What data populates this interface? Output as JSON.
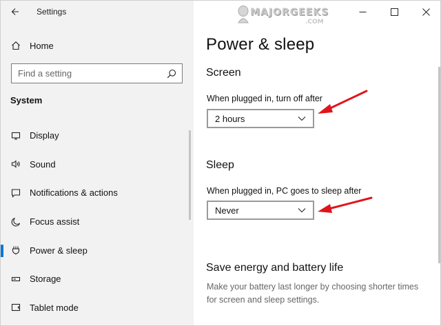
{
  "window": {
    "app_title": "Settings",
    "back_icon": "arrow-left-icon",
    "controls": [
      "minimize-icon",
      "maximize-icon",
      "close-icon"
    ]
  },
  "watermark": {
    "brand": "MAJORGEEKS",
    "suffix": ".COM"
  },
  "sidebar": {
    "home_label": "Home",
    "search_placeholder": "Find a setting",
    "section_label": "System",
    "active_item": "Power & sleep",
    "items": [
      {
        "label": "Display",
        "icon": "monitor-icon"
      },
      {
        "label": "Sound",
        "icon": "speaker-icon"
      },
      {
        "label": "Notifications & actions",
        "icon": "notifications-icon"
      },
      {
        "label": "Focus assist",
        "icon": "moon-icon"
      },
      {
        "label": "Power & sleep",
        "icon": "power-icon"
      },
      {
        "label": "Storage",
        "icon": "storage-icon"
      },
      {
        "label": "Tablet mode",
        "icon": "tablet-icon"
      }
    ]
  },
  "main": {
    "title": "Power & sleep",
    "screen": {
      "heading": "Screen",
      "label": "When plugged in, turn off after",
      "value": "2 hours"
    },
    "sleep": {
      "heading": "Sleep",
      "label": "When plugged in, PC goes to sleep after",
      "value": "Never"
    },
    "energy": {
      "heading": "Save energy and battery life",
      "description": "Make your battery last longer by choosing shorter times for screen and sleep settings."
    }
  },
  "colors": {
    "accent": "#0078d7",
    "annotation_arrow": "#e0141b",
    "sidebar_bg": "#f2f2f2"
  }
}
